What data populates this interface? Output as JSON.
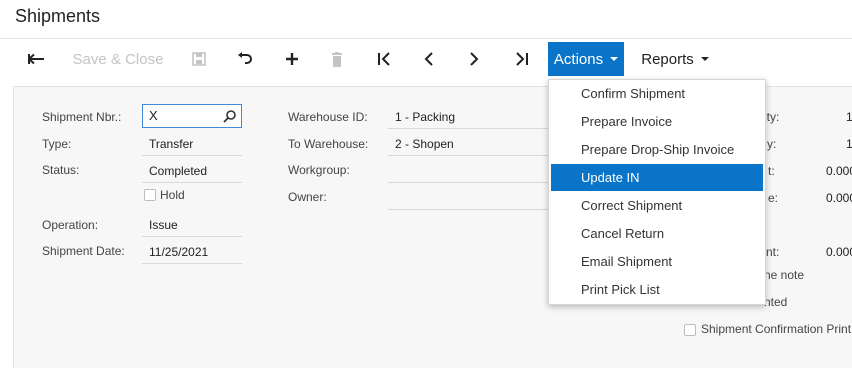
{
  "page": {
    "title": "Shipments"
  },
  "toolbar": {
    "save_close_label": "Save & Close",
    "actions_label": "Actions",
    "reports_label": "Reports"
  },
  "form": {
    "shipment_nbr_label": "Shipment Nbr.:",
    "shipment_nbr_value": "X",
    "type_label": "Type:",
    "type_value": "Transfer",
    "status_label": "Status:",
    "status_value": "Completed",
    "hold_label": "Hold",
    "operation_label": "Operation:",
    "operation_value": "Issue",
    "shipment_date_label": "Shipment Date:",
    "shipment_date_value": "11/25/2021",
    "warehouse_id_label": "Warehouse ID:",
    "warehouse_id_value": "1 - Packing",
    "to_warehouse_label": "To Warehouse:",
    "to_warehouse_value": "2 - Shopen",
    "workgroup_label": "Workgroup:",
    "owner_label": "Owner:"
  },
  "right_partial": {
    "label_1": "ity:",
    "value_1": "1",
    "label_2": "y:",
    "value_2": "1",
    "label_3": "t:",
    "value_3": "0.000",
    "label_4": "e:",
    "value_4": "0.000",
    "label_5": "nt:",
    "value_5": "0.000",
    "check_1_label": "ne note",
    "check_2_label": "nted",
    "check_3_label": "Shipment Confirmation Print"
  },
  "actions_menu": {
    "items": [
      {
        "label": "Confirm Shipment"
      },
      {
        "label": "Prepare Invoice"
      },
      {
        "label": "Prepare Drop-Ship Invoice"
      },
      {
        "label": "Update IN"
      },
      {
        "label": "Correct Shipment"
      },
      {
        "label": "Cancel Return"
      },
      {
        "label": "Email Shipment"
      },
      {
        "label": "Print Pick List"
      }
    ],
    "active_item": "Update IN"
  },
  "colors": {
    "accent": "#0a74c9"
  }
}
